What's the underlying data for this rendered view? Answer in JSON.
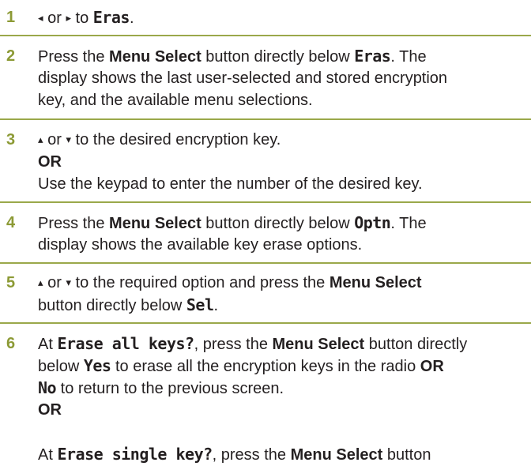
{
  "steps": [
    {
      "number": "1",
      "lines": [
        [
          {
            "t": "◂",
            "s": "arrow"
          },
          {
            "t": " or "
          },
          {
            "t": "▸",
            "s": "arrow"
          },
          {
            "t": " to "
          },
          {
            "t": "Eras",
            "s": "disp"
          },
          {
            "t": "."
          }
        ]
      ]
    },
    {
      "number": "2",
      "lines": [
        [
          {
            "t": "Press the "
          },
          {
            "t": "Menu Select",
            "s": "b"
          },
          {
            "t": " button directly below "
          },
          {
            "t": "Eras",
            "s": "disp"
          },
          {
            "t": ". The"
          }
        ],
        [
          {
            "t": "display shows the last user-selected and stored encryption"
          }
        ],
        [
          {
            "t": "key, and the available menu selections."
          }
        ]
      ]
    },
    {
      "number": "3",
      "lines": [
        [
          {
            "t": "▴",
            "s": "arrow"
          },
          {
            "t": " or "
          },
          {
            "t": "▾",
            "s": "arrow"
          },
          {
            "t": " to the desired encryption key."
          }
        ],
        [
          {
            "t": "OR",
            "s": "b"
          }
        ],
        [
          {
            "t": "Use the keypad to enter the number of the desired key."
          }
        ]
      ]
    },
    {
      "number": "4",
      "lines": [
        [
          {
            "t": "Press the "
          },
          {
            "t": "Menu Select",
            "s": "b"
          },
          {
            "t": " button directly below "
          },
          {
            "t": "Optn",
            "s": "disp"
          },
          {
            "t": ". The"
          }
        ],
        [
          {
            "t": "display shows the available key erase options."
          }
        ]
      ]
    },
    {
      "number": "5",
      "lines": [
        [
          {
            "t": "▴",
            "s": "arrow"
          },
          {
            "t": " or "
          },
          {
            "t": "▾",
            "s": "arrow"
          },
          {
            "t": " to the required option and press the "
          },
          {
            "t": "Menu Select",
            "s": "b"
          }
        ],
        [
          {
            "t": "button directly below "
          },
          {
            "t": "Sel",
            "s": "disp"
          },
          {
            "t": "."
          }
        ]
      ]
    },
    {
      "number": "6",
      "lines": [
        [
          {
            "t": "At "
          },
          {
            "t": "Erase all keys?",
            "s": "disp"
          },
          {
            "t": ", press the "
          },
          {
            "t": "Menu Select",
            "s": "b"
          },
          {
            "t": " button directly"
          }
        ],
        [
          {
            "t": "below "
          },
          {
            "t": "Yes",
            "s": "disp"
          },
          {
            "t": " to erase all the encryption keys in the radio "
          },
          {
            "t": "OR",
            "s": "b"
          }
        ],
        [
          {
            "t": "No",
            "s": "disp"
          },
          {
            "t": " to return to the previous screen."
          }
        ],
        [
          {
            "t": "OR",
            "s": "b"
          }
        ],
        [],
        [
          {
            "t": "At "
          },
          {
            "t": "Erase single key?",
            "s": "disp"
          },
          {
            "t": ", press the "
          },
          {
            "t": "Menu Select",
            "s": "b"
          },
          {
            "t": " button"
          }
        ]
      ]
    }
  ]
}
